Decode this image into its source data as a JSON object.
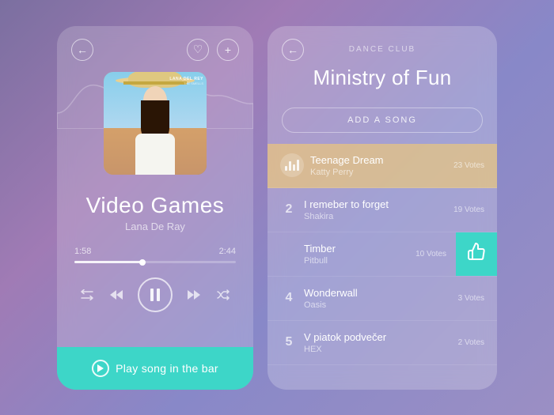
{
  "left": {
    "back_label": "←",
    "heart_label": "♡",
    "plus_label": "+",
    "song_title": "Video Games",
    "song_artist": "Lana De Ray",
    "time_current": "1:58",
    "time_total": "2:44",
    "progress_pct": 42,
    "controls": {
      "repeat": "⇄",
      "rewind": "⏮",
      "pause": "⏸",
      "forward": "⏭",
      "shuffle": "⇌"
    },
    "play_bar_label": "Play song in the bar"
  },
  "right": {
    "back_label": "←",
    "venue_category": "DANCE CLUB",
    "venue_name": "Ministry of Fun",
    "add_song_label": "ADD A SONG",
    "songs": [
      {
        "rank": "icon",
        "title": "Teenage Dream",
        "artist": "Katty Perry",
        "votes": "23 Votes",
        "active": true
      },
      {
        "rank": "2",
        "title": "I remeber to forget",
        "artist": "Shakira",
        "votes": "19 Votes",
        "active": false
      },
      {
        "rank": "",
        "title": "Timber",
        "artist": "Pitbull",
        "votes": "10 Votes",
        "active": false,
        "has_action": true
      },
      {
        "rank": "4",
        "title": "Wonderwall",
        "artist": "Oasis",
        "votes": "3 Votes",
        "active": false
      },
      {
        "rank": "5",
        "title": "V piatok podvečer",
        "artist": "HEX",
        "votes": "2 Votes",
        "active": false
      }
    ]
  }
}
